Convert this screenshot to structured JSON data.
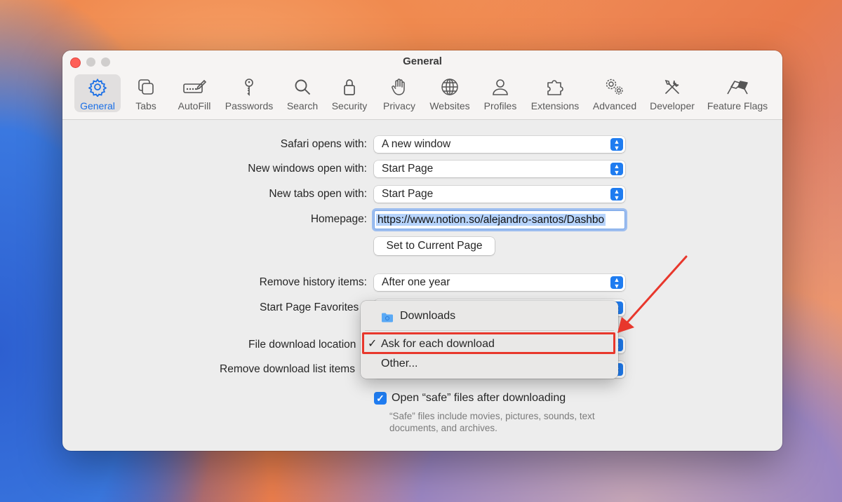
{
  "window": {
    "title": "General"
  },
  "toolbar": [
    {
      "label": "General",
      "icon": "gear-icon",
      "active": true
    },
    {
      "label": "Tabs",
      "icon": "tabs-icon"
    },
    {
      "label": "AutoFill",
      "icon": "autofill-icon"
    },
    {
      "label": "Passwords",
      "icon": "key-icon"
    },
    {
      "label": "Search",
      "icon": "magnifier-icon"
    },
    {
      "label": "Security",
      "icon": "lock-icon"
    },
    {
      "label": "Privacy",
      "icon": "hand-icon"
    },
    {
      "label": "Websites",
      "icon": "globe-icon"
    },
    {
      "label": "Profiles",
      "icon": "person-icon"
    },
    {
      "label": "Extensions",
      "icon": "puzzle-icon"
    },
    {
      "label": "Advanced",
      "icon": "gears-icon"
    },
    {
      "label": "Developer",
      "icon": "tools-icon"
    },
    {
      "label": "Feature Flags",
      "icon": "flags-icon"
    }
  ],
  "settings": {
    "safari_opens_with": {
      "label": "Safari opens with:",
      "value": "A new window"
    },
    "new_windows": {
      "label": "New windows open with:",
      "value": "Start Page"
    },
    "new_tabs": {
      "label": "New tabs open with:",
      "value": "Start Page"
    },
    "homepage": {
      "label": "Homepage:",
      "value": "https://www.notion.so/alejandro-santos/Dashbo"
    },
    "set_current_page": "Set to Current Page",
    "remove_history": {
      "label": "Remove history items:",
      "value": "After one year"
    },
    "start_page_favorites": {
      "label": "Start Page Favorites"
    },
    "file_download_location": {
      "label": "File download location"
    },
    "remove_download_list": {
      "label": "Remove download list items"
    },
    "open_safe_files": {
      "label": "Open “safe” files after downloading",
      "checked": true
    },
    "safe_help": "“Safe” files include movies, pictures, sounds, text documents, and archives.",
    "help_button": "?"
  },
  "menu": {
    "items": [
      {
        "label": "Downloads",
        "icon": "folder-icon"
      },
      {
        "label": "Ask for each download",
        "checked": true,
        "check_mark": "✓"
      },
      {
        "label": "Other..."
      }
    ]
  },
  "colors": {
    "accent": "#1f7cf0",
    "annotation": "#e8372c"
  }
}
